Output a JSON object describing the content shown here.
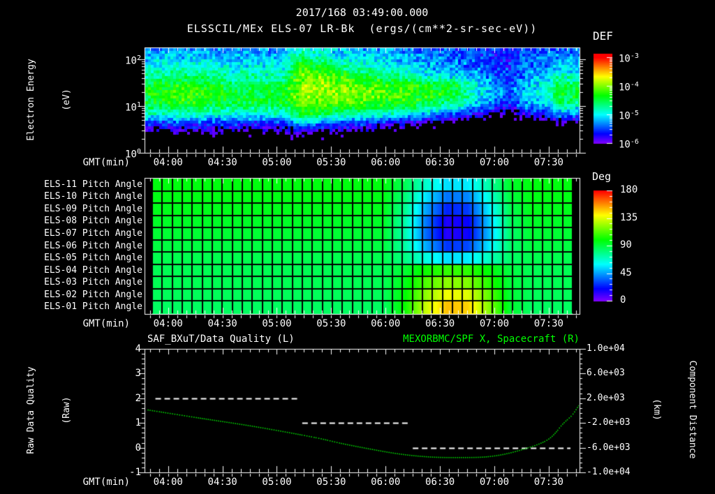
{
  "header": {
    "timestamp_title": "2017/168 03:49:00.000",
    "dataset_title": "ELSSCIL/MEx ELS-07 LR-Bk  (ergs/(cm**2-sr-sec-eV))"
  },
  "colors": {
    "background": "#000000",
    "axis": "#ffffff",
    "text": "#ffffff",
    "quality_series": "#ffffff",
    "distance_series": "#00d800",
    "right_title_green": "#00ff00",
    "colormap_low_to_high": [
      "#8000ff",
      "#0000ff",
      "#00ffff",
      "#00ff00",
      "#ffff00",
      "#ff8000",
      "#ff0000"
    ]
  },
  "time_axis": {
    "label": "GMT(min)",
    "start": "03:47",
    "end": "07:47",
    "major_tick_labels": [
      "04:00",
      "04:30",
      "05:00",
      "05:30",
      "06:00",
      "06:30",
      "07:00",
      "07:30"
    ],
    "minor_tick_minutes": 5
  },
  "chart_data": [
    {
      "id": "electron-energy-spectrogram",
      "type": "heatmap",
      "y_axis": {
        "label_lines": [
          "Electron Energy",
          "(eV)"
        ],
        "scale": "log",
        "energy_range_ev": [
          1,
          178
        ],
        "ticks": [
          {
            "base": "10",
            "exp": "2"
          },
          {
            "base": "10",
            "exp": "1"
          },
          {
            "base": "10",
            "exp": "0"
          }
        ]
      },
      "colorbar": {
        "title": "DEF",
        "units": "ergs/(cm**2-sr-sec-eV)",
        "ticks": [
          {
            "base": "10",
            "exp": "-3"
          },
          {
            "base": "10",
            "exp": "-4"
          },
          {
            "base": "10",
            "exp": "-5"
          },
          {
            "base": "10",
            "exp": "-6"
          }
        ]
      },
      "log10_def_grid": {
        "note": "columns over time 03:47-07:47, each column = 12 log10(DEF) values from 178 eV (top) to 1 eV (bottom)",
        "col_times": [
          "03:47",
          "03:57",
          "04:06",
          "04:16",
          "04:25",
          "04:35",
          "04:45",
          "04:54",
          "05:04",
          "05:13",
          "05:23",
          "05:33",
          "05:42",
          "05:52",
          "06:01",
          "06:11",
          "06:21",
          "06:30",
          "06:40",
          "06:49",
          "06:59",
          "07:09",
          "07:18",
          "07:28",
          "07:37",
          "07:47"
        ],
        "columns": [
          [
            -5.3,
            -5.15,
            -5.0,
            -4.75,
            -4.5,
            -4.4,
            -4.5,
            -4.9,
            -5.6,
            -6.15,
            -6.35,
            -6.45
          ],
          [
            -5.3,
            -5.1,
            -4.95,
            -4.7,
            -4.4,
            -4.3,
            -4.45,
            -4.9,
            -5.6,
            -6.1,
            -6.35,
            -6.45
          ],
          [
            -5.25,
            -5.1,
            -4.9,
            -4.6,
            -4.3,
            -4.2,
            -4.35,
            -4.85,
            -5.55,
            -6.1,
            -6.35,
            -6.45
          ],
          [
            -5.25,
            -5.1,
            -4.9,
            -4.6,
            -4.3,
            -4.2,
            -4.35,
            -4.85,
            -5.55,
            -6.1,
            -6.35,
            -6.45
          ],
          [
            -5.3,
            -5.1,
            -4.95,
            -4.7,
            -4.45,
            -4.35,
            -4.45,
            -4.9,
            -5.55,
            -6.1,
            -6.35,
            -6.45
          ],
          [
            -5.3,
            -5.15,
            -5.0,
            -4.8,
            -4.55,
            -4.45,
            -4.55,
            -4.95,
            -5.6,
            -6.15,
            -6.35,
            -6.45
          ],
          [
            -5.3,
            -5.15,
            -5.0,
            -4.8,
            -4.55,
            -4.45,
            -4.55,
            -4.95,
            -5.6,
            -6.15,
            -6.35,
            -6.45
          ],
          [
            -5.3,
            -5.15,
            -5.0,
            -4.8,
            -4.55,
            -4.45,
            -4.55,
            -4.95,
            -5.6,
            -6.15,
            -6.35,
            -6.45
          ],
          [
            -5.25,
            -5.1,
            -4.95,
            -4.75,
            -4.5,
            -4.4,
            -4.5,
            -4.9,
            -5.6,
            -6.15,
            -6.35,
            -6.45
          ],
          [
            -4.9,
            -4.55,
            -4.25,
            -4.05,
            -3.95,
            -3.95,
            -4.1,
            -4.4,
            -5.1,
            -5.9,
            -6.25,
            -6.45
          ],
          [
            -5.05,
            -4.8,
            -4.4,
            -4.05,
            -3.95,
            -3.95,
            -4.15,
            -4.55,
            -5.35,
            -6.05,
            -6.3,
            -6.45
          ],
          [
            -5.2,
            -5.0,
            -4.6,
            -4.2,
            -4.05,
            -4.0,
            -4.2,
            -4.7,
            -5.5,
            -6.1,
            -6.35,
            -6.45
          ],
          [
            -5.25,
            -5.05,
            -4.75,
            -4.35,
            -4.1,
            -4.05,
            -4.25,
            -4.75,
            -5.55,
            -6.15,
            -6.4,
            -6.5
          ],
          [
            -5.3,
            -5.1,
            -4.85,
            -4.5,
            -4.15,
            -4.1,
            -4.3,
            -4.8,
            -5.6,
            -6.2,
            -6.4,
            -6.5
          ],
          [
            -5.3,
            -5.15,
            -4.95,
            -4.6,
            -4.2,
            -4.15,
            -4.35,
            -4.9,
            -5.7,
            -6.25,
            -6.45,
            -6.5
          ],
          [
            -5.35,
            -5.2,
            -5.0,
            -4.7,
            -4.25,
            -4.2,
            -4.4,
            -5.0,
            -5.8,
            -6.3,
            -6.45,
            -6.55
          ],
          [
            -5.4,
            -5.3,
            -5.15,
            -4.9,
            -4.35,
            -4.3,
            -4.55,
            -5.2,
            -6.0,
            -6.4,
            -6.5,
            -6.55
          ],
          [
            -5.45,
            -5.35,
            -5.25,
            -5.0,
            -4.4,
            -4.35,
            -4.65,
            -5.35,
            -6.15,
            -6.45,
            -6.55,
            -6.6
          ],
          [
            -5.5,
            -5.4,
            -5.3,
            -5.1,
            -4.5,
            -4.45,
            -4.8,
            -5.5,
            -6.3,
            -6.5,
            -6.6,
            -6.6
          ],
          [
            -5.55,
            -5.45,
            -5.4,
            -5.2,
            -4.95,
            -4.9,
            -5.1,
            -5.7,
            -6.4,
            -6.55,
            -6.6,
            -6.6
          ],
          [
            -5.6,
            -5.5,
            -5.5,
            -5.4,
            -5.2,
            -5.15,
            -5.4,
            -5.9,
            -6.5,
            -6.6,
            -6.65,
            -6.65
          ],
          [
            -5.75,
            -5.65,
            -5.6,
            -5.55,
            -5.5,
            -5.45,
            -5.65,
            -6.1,
            -6.55,
            -6.65,
            -6.65,
            -6.65
          ],
          [
            -5.55,
            -5.45,
            -5.35,
            -5.25,
            -5.15,
            -5.1,
            -5.3,
            -5.7,
            -6.3,
            -6.55,
            -6.6,
            -6.6
          ],
          [
            -5.5,
            -5.4,
            -5.3,
            -5.15,
            -5.0,
            -4.95,
            -5.2,
            -5.6,
            -6.25,
            -6.5,
            -6.6,
            -6.6
          ],
          [
            -5.45,
            -5.3,
            -5.1,
            -4.8,
            -4.45,
            -4.4,
            -4.65,
            -5.25,
            -6.1,
            -6.45,
            -6.55,
            -6.6
          ],
          [
            -5.4,
            -5.3,
            -5.15,
            -4.95,
            -4.6,
            -4.5,
            -4.8,
            -5.4,
            -6.15,
            -6.5,
            -6.55,
            -6.6
          ]
        ]
      }
    },
    {
      "id": "pitch-angle-heatmap",
      "type": "heatmap",
      "row_labels": [
        "ELS-11 Pitch Angle",
        "ELS-10 Pitch Angle",
        "ELS-09 Pitch Angle",
        "ELS-08 Pitch Angle",
        "ELS-07 Pitch Angle",
        "ELS-06 Pitch Angle",
        "ELS-05 Pitch Angle",
        "ELS-04 Pitch Angle",
        "ELS-03 Pitch Angle",
        "ELS-02 Pitch Angle",
        "ELS-01 Pitch Angle"
      ],
      "colorbar": {
        "title": "Deg",
        "ticks": [
          "180",
          "135",
          "90",
          "45",
          "0"
        ]
      },
      "value_range_deg": [
        0,
        180
      ],
      "pitch_deg_grid": {
        "col_times": [
          "03:47",
          "03:59",
          "04:11",
          "04:23",
          "04:35",
          "04:47",
          "04:59",
          "05:11",
          "05:23",
          "05:35",
          "05:47",
          "05:59",
          "06:11",
          "06:23",
          "06:35",
          "06:47",
          "06:59",
          "07:11",
          "07:23",
          "07:35",
          "07:47"
        ],
        "rows": [
          [
            98,
            98,
            98,
            98,
            98,
            98,
            98,
            98,
            98,
            98,
            98,
            98,
            87,
            68,
            55,
            57,
            74,
            93,
            98,
            98,
            98
          ],
          [
            97,
            97,
            97,
            97,
            97,
            97,
            97,
            97,
            97,
            97,
            97,
            97,
            82,
            56,
            38,
            41,
            65,
            90,
            97,
            97,
            97
          ],
          [
            96,
            96,
            96,
            96,
            96,
            96,
            96,
            96,
            96,
            96,
            96,
            96,
            78,
            46,
            25,
            29,
            57,
            87,
            96,
            96,
            96
          ],
          [
            94,
            94,
            94,
            94,
            94,
            94,
            94,
            94,
            94,
            94,
            94,
            94,
            74,
            39,
            15,
            19,
            51,
            85,
            94,
            94,
            94
          ],
          [
            92,
            92,
            92,
            92,
            92,
            92,
            92,
            92,
            92,
            92,
            92,
            92,
            73,
            37,
            14,
            18,
            49,
            83,
            92,
            92,
            92
          ],
          [
            90,
            90,
            90,
            90,
            90,
            90,
            90,
            90,
            90,
            90,
            90,
            90,
            75,
            47,
            28,
            31,
            56,
            83,
            90,
            90,
            90
          ],
          [
            88,
            88,
            88,
            88,
            88,
            88,
            88,
            88,
            88,
            88,
            88,
            88,
            80,
            65,
            55,
            57,
            70,
            84,
            88,
            88,
            88
          ],
          [
            87,
            87,
            87,
            87,
            87,
            87,
            87,
            87,
            87,
            87,
            87,
            87,
            92,
            102,
            108,
            107,
            99,
            90,
            87,
            87,
            87
          ],
          [
            87,
            87,
            87,
            87,
            87,
            87,
            87,
            87,
            87,
            87,
            87,
            87,
            96,
            112,
            122,
            120,
            106,
            91,
            87,
            87,
            87
          ],
          [
            86,
            86,
            86,
            86,
            86,
            86,
            86,
            86,
            86,
            86,
            86,
            86,
            99,
            122,
            138,
            135,
            115,
            92,
            86,
            86,
            86
          ],
          [
            85,
            85,
            85,
            85,
            85,
            85,
            85,
            85,
            85,
            85,
            85,
            85,
            101,
            131,
            150,
            147,
            121,
            93,
            85,
            85,
            85
          ]
        ]
      }
    },
    {
      "id": "data-quality-and-spacecraft-distance",
      "type": "line",
      "titles": {
        "left": "SAF_BXuT/Data Quality (L)",
        "right": "MEXORBMC/SPF X, Spacecraft (R)"
      },
      "y_left": {
        "label_lines": [
          "Raw Data Quality",
          "(Raw)"
        ],
        "range": [
          -1,
          4
        ],
        "tick_labels": [
          "4",
          "3",
          "2",
          "1",
          "0",
          "-1"
        ]
      },
      "y_right": {
        "label_lines": [
          "Component Distance",
          "(km)"
        ],
        "range": [
          -10000,
          10000
        ],
        "tick_labels": [
          "1.0e+04",
          "6.0e+03",
          "2.0e+03",
          "-2.0e+03",
          "-6.0e+03",
          "-1.0e+04"
        ]
      },
      "series": [
        {
          "name": "SAF_BXuT/Data Quality",
          "axis": "left",
          "style": "white-dashed-steps",
          "segments": [
            {
              "value": 2,
              "start": "03:53",
              "end": "05:13"
            },
            {
              "value": 1,
              "start": "05:14",
              "end": "06:13"
            },
            {
              "value": 0,
              "start": "06:15",
              "end": "07:42"
            }
          ]
        },
        {
          "name": "MEXORBMC/SPF X Spacecraft",
          "axis": "right",
          "style": "green-dotted-curve",
          "points_time_km": [
            [
              "03:49",
              100
            ],
            [
              "04:16",
              -1150
            ],
            [
              "04:48",
              -2600
            ],
            [
              "05:20",
              -4300
            ],
            [
              "05:36",
              -5340
            ],
            [
              "05:52",
              -6250
            ],
            [
              "06:08",
              -7040
            ],
            [
              "06:24",
              -7500
            ],
            [
              "06:40",
              -7600
            ],
            [
              "06:57",
              -7450
            ],
            [
              "07:12",
              -6600
            ],
            [
              "07:29",
              -4800
            ],
            [
              "07:38",
              -2100
            ],
            [
              "07:43",
              -700
            ],
            [
              "07:47",
              1000
            ]
          ]
        }
      ]
    }
  ]
}
